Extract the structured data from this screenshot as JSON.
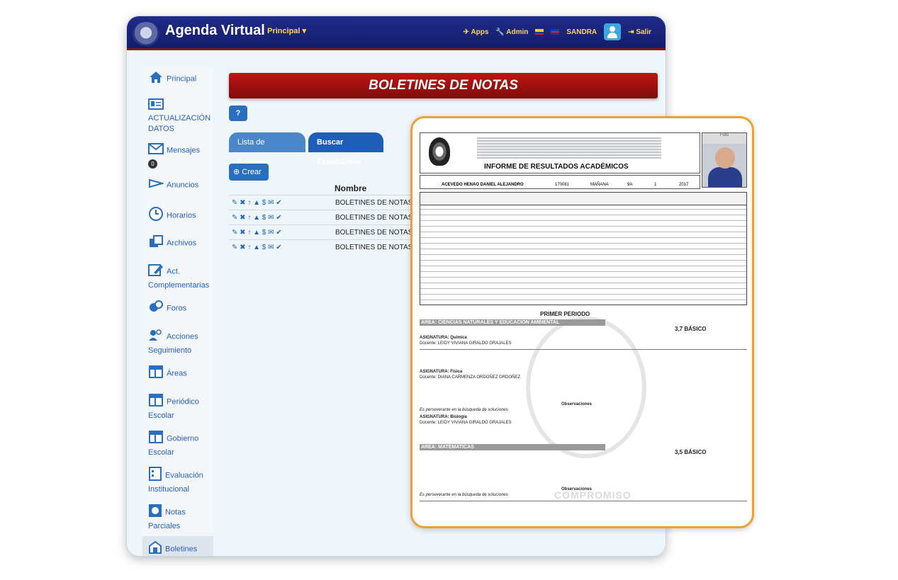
{
  "app": {
    "title": "Agenda Virtual",
    "menu": "Principal ▾"
  },
  "nav": {
    "apps": "✈ Apps",
    "admin": "🔧 Admin",
    "user": "SANDRA",
    "logout": "⇥ Salir"
  },
  "sidebar": {
    "items": [
      {
        "label": "Principal",
        "icon": "home-icon"
      },
      {
        "label": "ACTUALIZACIÓN DATOS",
        "icon": "id-card-icon"
      },
      {
        "label": "Mensajes",
        "icon": "envelope-icon",
        "badge": "0"
      },
      {
        "label": "Anuncios",
        "icon": "megaphone-icon"
      },
      {
        "label": "Horarios",
        "icon": "clock-icon"
      },
      {
        "label": "Archivos",
        "icon": "files-icon"
      },
      {
        "label": "Act. Complementarias",
        "icon": "edit-icon"
      },
      {
        "label": "Foros",
        "icon": "chat-icon"
      },
      {
        "label": "Acciones Seguimiento",
        "icon": "people-icon"
      },
      {
        "label": "Áreas",
        "icon": "table-icon"
      },
      {
        "label": "Periódico Escolar",
        "icon": "table-icon"
      },
      {
        "label": "Gobierno Escolar",
        "icon": "table-icon"
      },
      {
        "label": "Evaluación Institucional",
        "icon": "form-icon"
      },
      {
        "label": "Notas Parciales",
        "icon": "chart-icon"
      },
      {
        "label": "Boletines de Notas",
        "icon": "diploma-icon"
      }
    ]
  },
  "main": {
    "banner": "BOLETINES DE NOTAS",
    "help": "?",
    "tabs": [
      "Lista de Boletines",
      "Buscar Estudiantes"
    ],
    "crear": "⊕ Crear",
    "column": "Nombre",
    "rows": [
      "BOLETINES DE NOTAS P",
      "BOLETINES DE NOTAS S",
      "BOLETINES DE NOTAS T",
      "BOLETINES DE NOTAS C"
    ],
    "row_actions": "✎ ✖ ↑ ▲ $ ✉ ✔"
  },
  "report": {
    "title": "INFORME DE RESULTADOS ACADÉMICOS",
    "photo_label": "Foto",
    "student": "ACEVEDO HENAO DANIEL ALEJANDRO",
    "code": "170081",
    "jornada": "MAÑANA",
    "grupo": "9A",
    "periodo": "1",
    "year": "2017",
    "periodo_title": "PRIMER PERIODO",
    "area1": "AREA: CIENCIAS NATURALES Y EDUCACION AMBIENTAL",
    "area1_grade": "3,7 BÁSICO",
    "subject1": "ASIGNATURA: Química",
    "teacher1": "Docente: LEIDY VIVIANA GIRALDO GRAJALES",
    "subject2": "ASIGNATURA: Física",
    "teacher2": "Docente: DIANA CARMENZA ORDOÑEZ ORDOÑEZ",
    "subject3": "ASIGNATURA: Biología",
    "teacher3": "Docente: LEIDY VIVIANA GIRALDO GRAJALES",
    "area2": "AREA: MATEMATICAS",
    "area2_grade": "3,5 BÁSICO",
    "observaciones": "Observaciones",
    "obs_text": "Es perseverante en la búsqueda de soluciones",
    "watermark": "COMPROMISO"
  }
}
